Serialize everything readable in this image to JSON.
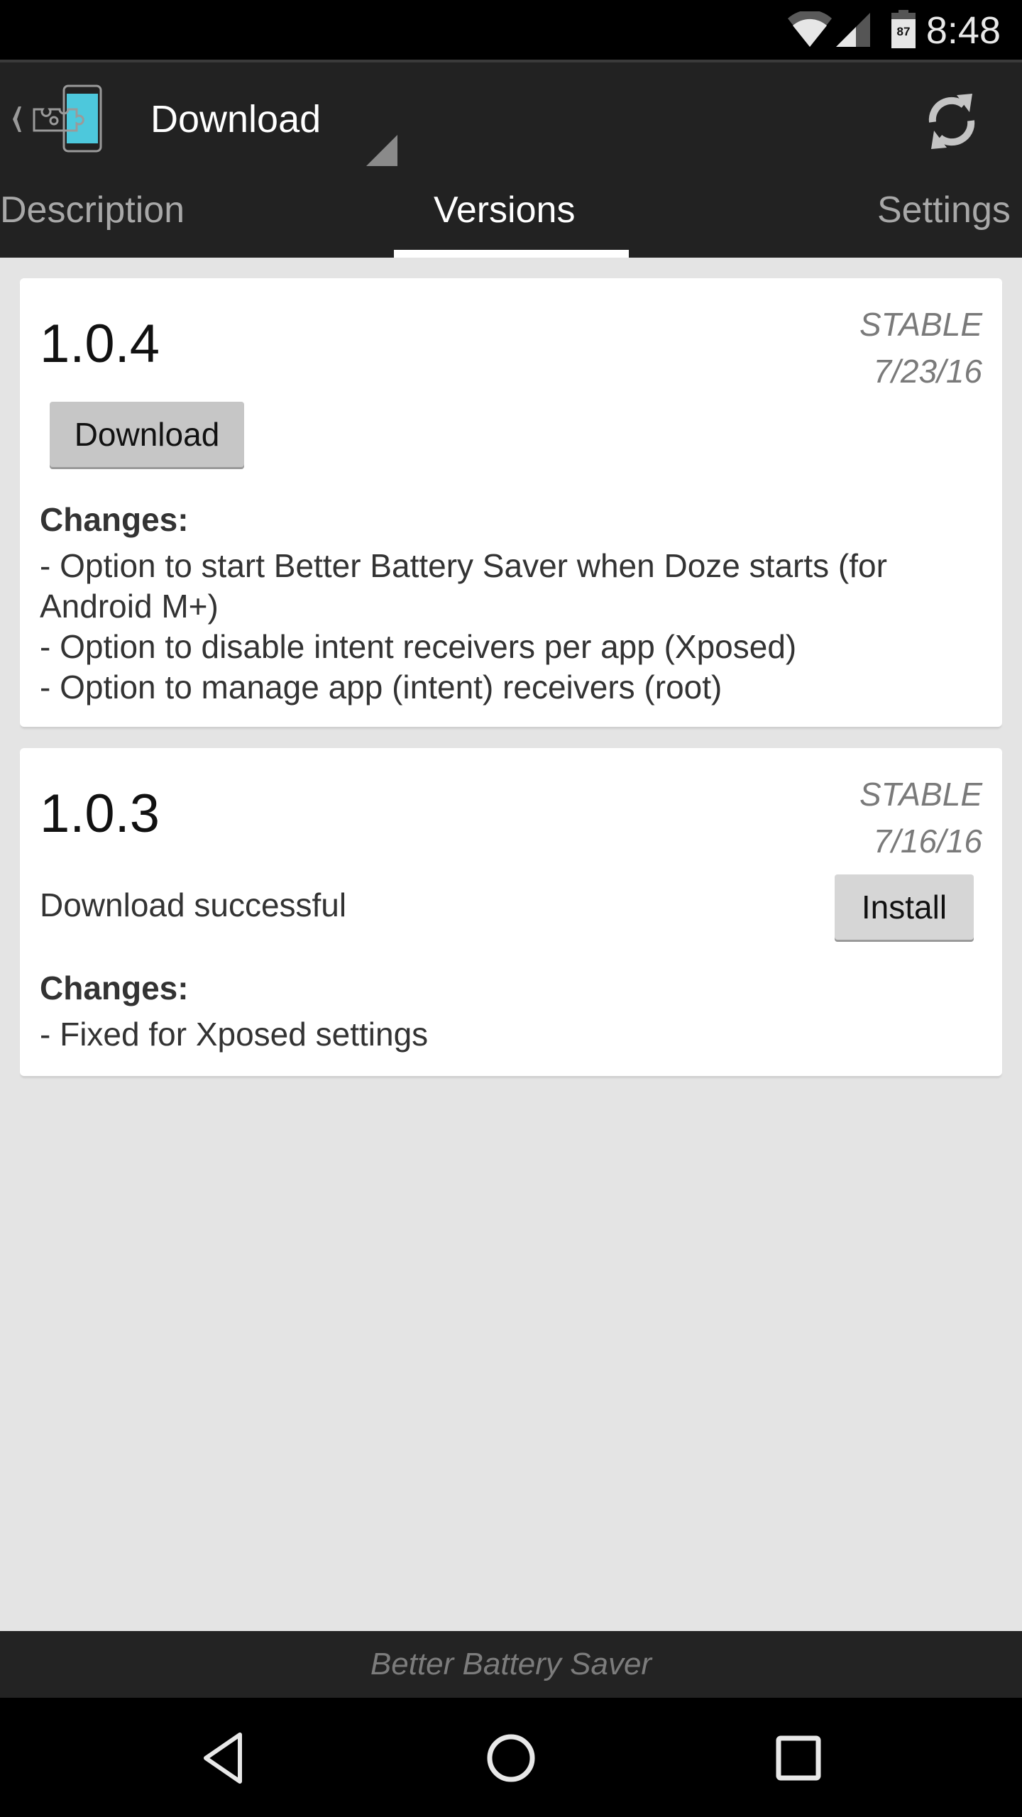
{
  "status_bar": {
    "time": "8:48",
    "battery_level": "87",
    "icons": [
      "wifi-icon",
      "cell-signal-icon",
      "battery-icon"
    ]
  },
  "action_bar": {
    "title": "Download",
    "app_icon": "xposed-installer-icon",
    "refresh_icon": "refresh-icon"
  },
  "tabs": [
    {
      "label": "Description",
      "active": false
    },
    {
      "label": "Versions",
      "active": true
    },
    {
      "label": "Settings",
      "active": false
    }
  ],
  "versions": [
    {
      "version": "1.0.4",
      "channel": "STABLE",
      "date": "7/23/16",
      "action_label": "Download",
      "status": "",
      "changes_header": "Changes:",
      "changes": [
        "- Option to start Better Battery Saver when Doze starts (for Android M+)",
        "- Option to disable intent receivers per app (Xposed)",
        "- Option to manage app (intent) receivers (root)"
      ]
    },
    {
      "version": "1.0.3",
      "channel": "STABLE",
      "date": "7/16/16",
      "action_label": "Install",
      "status": "Download successful",
      "changes_header": "Changes:",
      "changes": [
        "- Fixed for Xposed settings"
      ]
    }
  ],
  "footer": {
    "module_name": "Better Battery Saver"
  },
  "nav_bar": {
    "buttons": [
      "back-icon",
      "home-icon",
      "recents-icon"
    ]
  },
  "colors": {
    "accent": "#4dc8dc",
    "bar_bg": "#222222",
    "content_bg": "#e4e4e4"
  }
}
